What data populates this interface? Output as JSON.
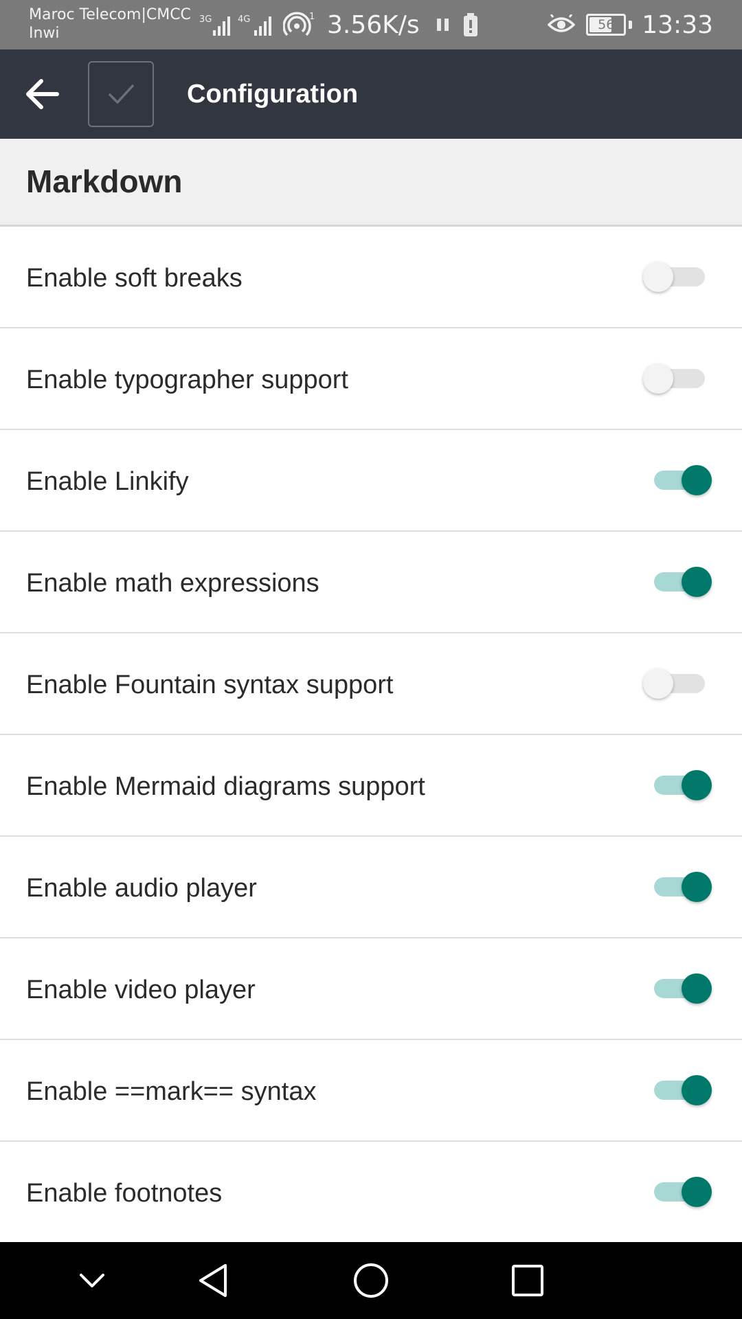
{
  "status_bar": {
    "carrier_line1": "Maroc Telecom|CMCC",
    "carrier_line2": "Inwi",
    "net_speed": "3.56K/s",
    "battery_level": "56",
    "time": "13:33",
    "icons": [
      "signal-3g-icon",
      "signal-4g-icon",
      "hotspot-icon",
      "pause-icon",
      "alert-icon",
      "eye-icon",
      "battery-icon"
    ]
  },
  "toolbar": {
    "title": "Configuration",
    "back_icon": "arrow-back-icon",
    "check_icon": "check-icon"
  },
  "section": {
    "title": "Markdown"
  },
  "settings": [
    {
      "label": "Enable soft breaks",
      "enabled": false
    },
    {
      "label": "Enable typographer support",
      "enabled": false
    },
    {
      "label": "Enable Linkify",
      "enabled": true
    },
    {
      "label": "Enable math expressions",
      "enabled": true
    },
    {
      "label": "Enable Fountain syntax support",
      "enabled": false
    },
    {
      "label": "Enable Mermaid diagrams support",
      "enabled": true
    },
    {
      "label": "Enable audio player",
      "enabled": true
    },
    {
      "label": "Enable video player",
      "enabled": true
    },
    {
      "label": "Enable ==mark== syntax",
      "enabled": true
    },
    {
      "label": "Enable footnotes",
      "enabled": true
    }
  ],
  "colors": {
    "toolbar_bg": "#323640",
    "accent": "#00796b",
    "accent_track": "#a7d8d3",
    "status_bar_bg": "#7a7a7a"
  },
  "nav_bar": {
    "icons": [
      "chevron-down-icon",
      "back-triangle-icon",
      "home-circle-icon",
      "recents-square-icon"
    ]
  }
}
